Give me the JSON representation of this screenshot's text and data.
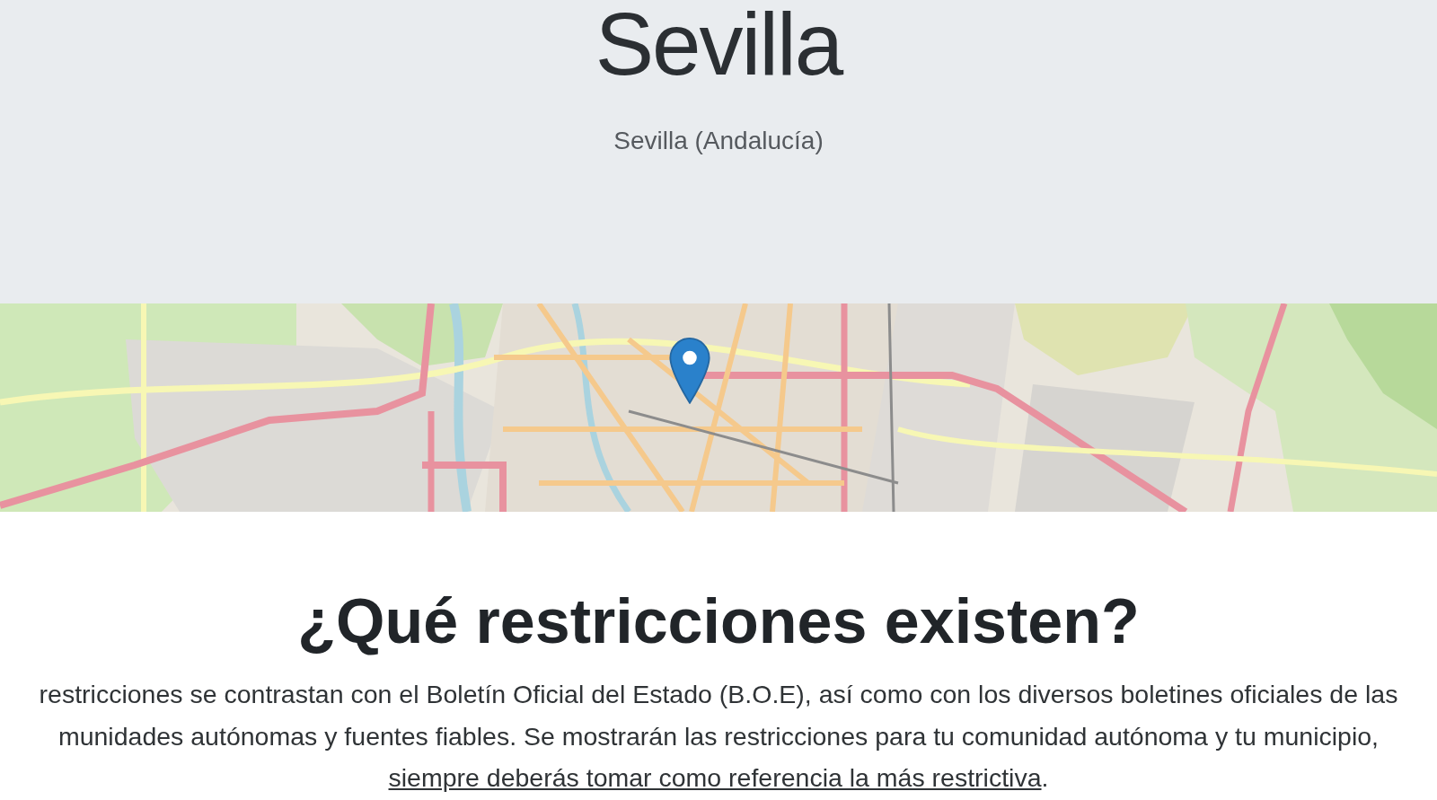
{
  "header": {
    "title": "Sevilla",
    "subtitle": "Sevilla (Andalucía)"
  },
  "section": {
    "heading": "¿Qué restricciones existen?",
    "paragraph": {
      "lines": [
        "restricciones se contrastan con el Boletín Oficial del Estado (B.O.E), así como con los diversos boletines oficiales de las",
        "munidades autónomas y fuentes fiables. Se mostrarán las restricciones para tu comunidad autónoma y tu municipio,"
      ],
      "link": "siempre deberás tomar como referencia la más restrictiva",
      "after_link": "."
    }
  }
}
